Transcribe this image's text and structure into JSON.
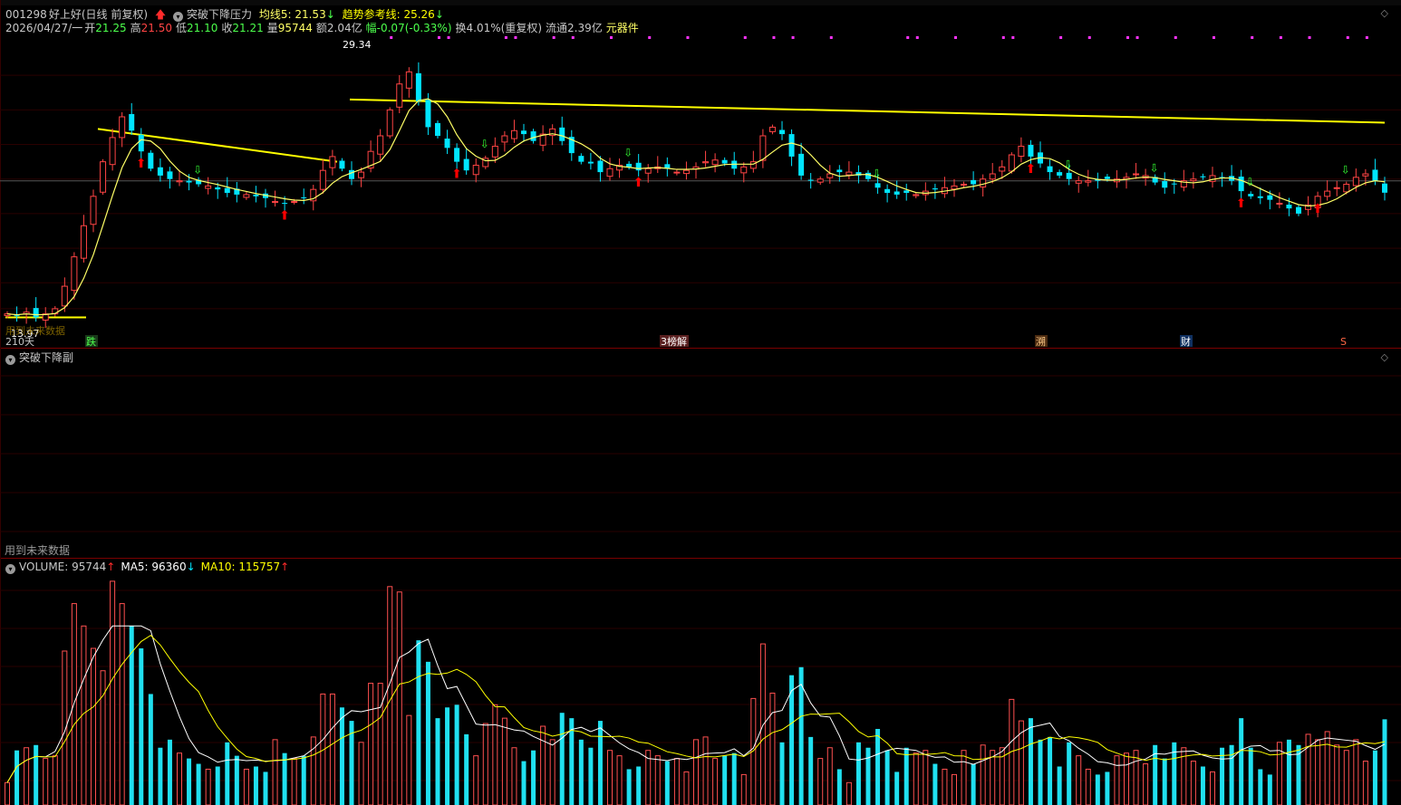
{
  "header": {
    "stock_code": "001298",
    "stock_name": "好上好",
    "period": "(日线 前复权)",
    "indicator_name": "突破下降压力",
    "ma5_label": "均线5: 21.53",
    "trend_label": "趋势参考线: 25.26",
    "date": "2026/04/27/一",
    "open_label": "开",
    "open": "21.25",
    "high_label": "高",
    "high": "21.50",
    "low_label": "低",
    "low": "21.10",
    "close_label": "收",
    "close": "21.21",
    "vol_label": "量",
    "vol": "95744",
    "amount": "额2.04亿",
    "change": "幅-0.07(-0.33%)",
    "turnover": "换4.01%(重复权)",
    "float_cap": "流通2.39亿",
    "sector": "元器件"
  },
  "main_panel": {
    "max_label": "29.34",
    "min_label": "13.97",
    "future_data": "用到未来数据",
    "days_label": "210天",
    "events": [
      "跌",
      "3榜解",
      "溯",
      "财",
      "S"
    ]
  },
  "sub_panel": {
    "title": "突破下降副",
    "future_data": "用到未来数据"
  },
  "volume_panel": {
    "volume_label": "VOLUME: 95744",
    "ma5_label": "MA5: 96360",
    "ma10_label": "MA10: 115757"
  },
  "colors": {
    "up": "#ff4444",
    "down": "#00e5ff",
    "ma5_line": "#ffffff",
    "ma10_line": "#ffff00",
    "price_ma": "#ffff66",
    "trend_line": "#ffff00",
    "signal_up": "#ff0000",
    "signal_dn": "#33ff33",
    "magenta": "#ff33ff"
  },
  "chart_data": {
    "type": "candlestick",
    "ohlc_approx_close": [
      14.2,
      14.1,
      14.3,
      14.0,
      14.2,
      14.5,
      15.8,
      17.5,
      19.3,
      21.0,
      23.0,
      24.4,
      25.6,
      24.8,
      23.6,
      22.6,
      22.2,
      22.0,
      21.9,
      21.8,
      21.7,
      21.6,
      21.4,
      21.2,
      21.1,
      21.1,
      21.0,
      20.9,
      20.7,
      20.6,
      20.7,
      20.9,
      21.4,
      22.5,
      23.3,
      22.6,
      22.0,
      22.4,
      23.6,
      24.5,
      26.0,
      27.5,
      28.2,
      26.5,
      25.0,
      24.5,
      23.8,
      23.0,
      22.5,
      22.8,
      23.2,
      23.9,
      24.5,
      24.8,
      24.6,
      24.2,
      24.6,
      24.9,
      24.2,
      23.5,
      23.0,
      22.9,
      22.4,
      22.6,
      22.8,
      22.7,
      22.5,
      22.6,
      22.7,
      22.6,
      22.4,
      22.5,
      22.7,
      23.0,
      23.1,
      22.9,
      22.6,
      22.7,
      23.0,
      24.5,
      25.0,
      24.6,
      23.3,
      22.2,
      21.9,
      22.0,
      22.3,
      22.4,
      22.4,
      22.2,
      22.0,
      21.5,
      21.2,
      21.1,
      21.2,
      21.1,
      21.3,
      21.4,
      21.5,
      21.6,
      21.7,
      21.7,
      22.0,
      22.3,
      22.7,
      23.4,
      23.9,
      23.3,
      22.9,
      22.4,
      22.2,
      22.0,
      21.9,
      21.9,
      21.9,
      22.0,
      22.0,
      22.1,
      22.3,
      22.2,
      21.8,
      21.5,
      21.7,
      21.9,
      22.0,
      22.1,
      22.2,
      22.1,
      21.9,
      21.3,
      21.0,
      20.9,
      20.8,
      20.6,
      20.3,
      20.0,
      20.5,
      21.0,
      21.3,
      21.5,
      21.7,
      22.1,
      22.3,
      21.9,
      21.21
    ],
    "ylim": [
      13.5,
      30.0
    ],
    "volume_ylim": [
      0,
      260000
    ],
    "volume_last": 95744,
    "volume_ma5_last": 96360,
    "volume_ma10_last": 115757
  }
}
